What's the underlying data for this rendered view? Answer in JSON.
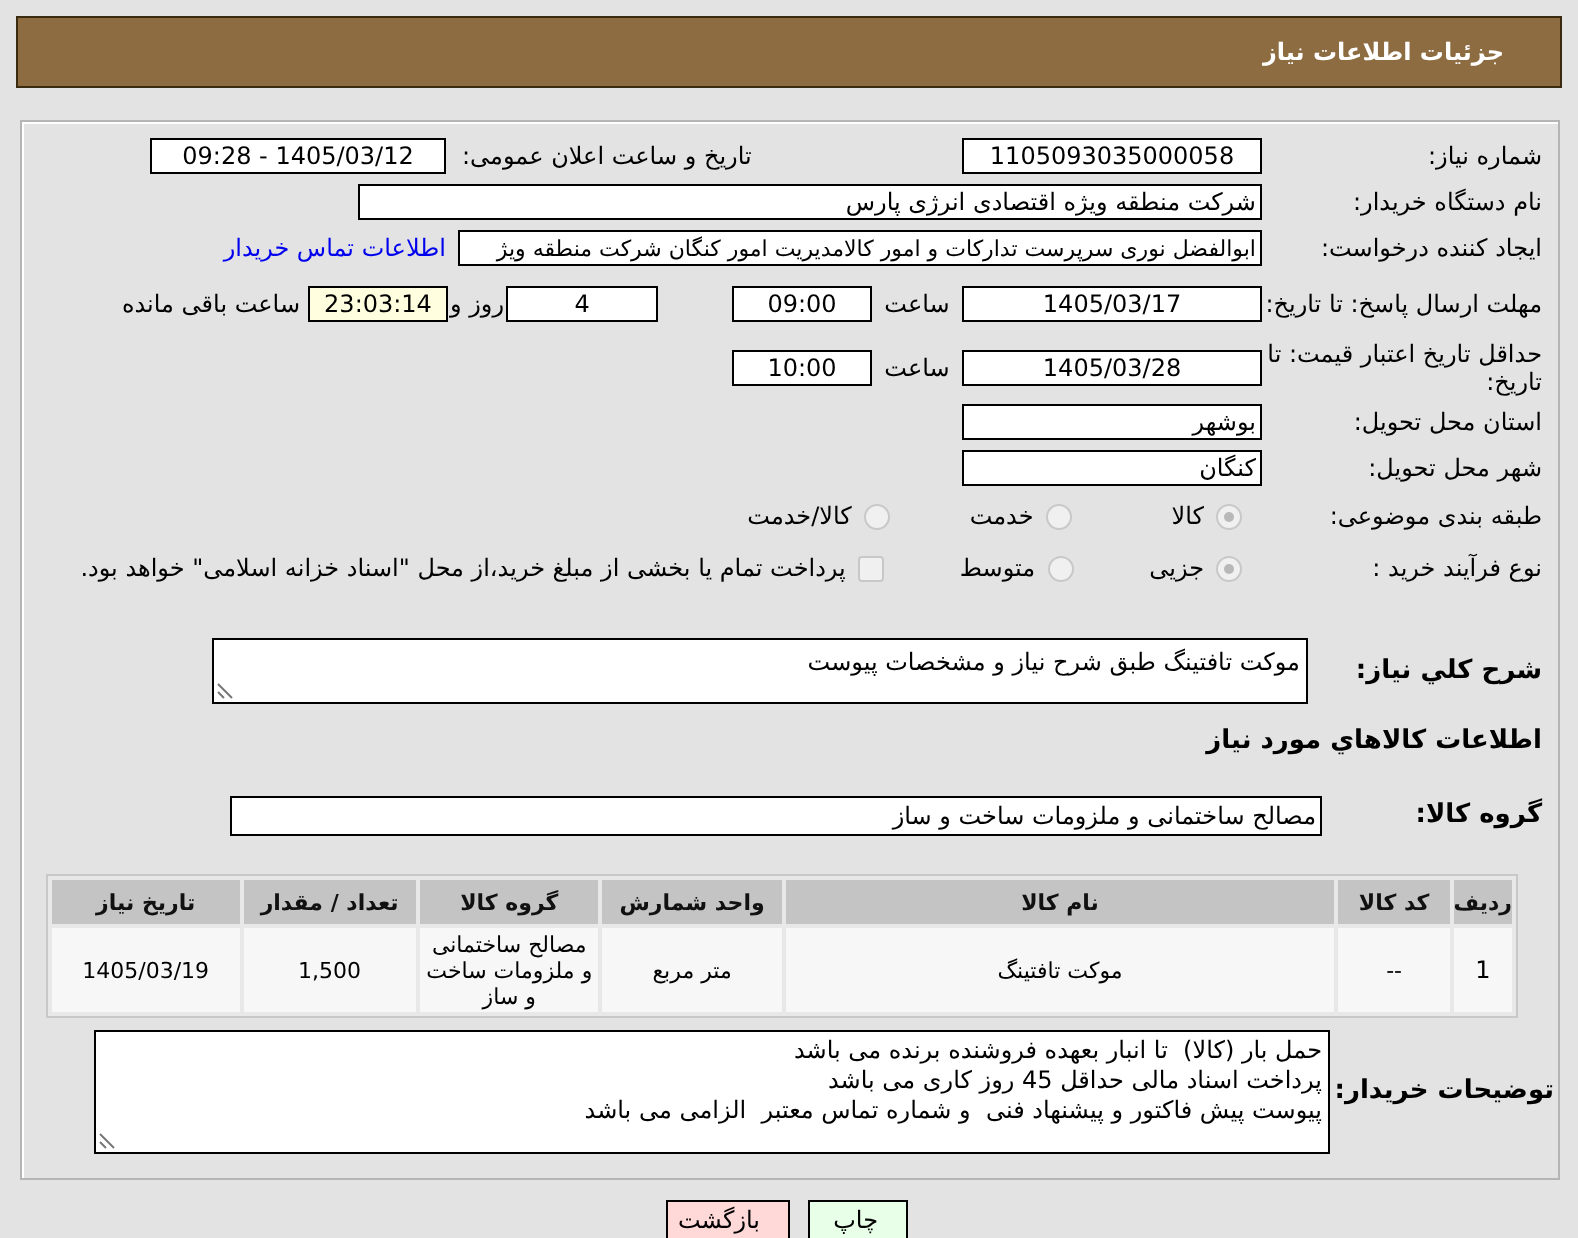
{
  "header": {
    "title": "جزئیات اطلاعات نیاز"
  },
  "need_number": {
    "label": "شماره نیاز:",
    "value": "1105093035000058"
  },
  "announce": {
    "label": "تاریخ و ساعت اعلان عمومی:",
    "value": "1405/03/12 - 09:28"
  },
  "buyer": {
    "label": "نام دستگاه خریدار:",
    "value": "شرکت منطقه ویژه اقتصادی انرژی پارس"
  },
  "requester": {
    "label": "ایجاد کننده درخواست:",
    "value": "ابوالفضل نوری سرپرست تدارکات و امور کالامدیریت امور کنگان شرکت منطقه ویژ",
    "link": "اطلاعات تماس خریدار"
  },
  "deadline": {
    "label": "مهلت ارسال پاسخ: تا تاریخ:",
    "date": "1405/03/17",
    "time_label": "ساعت",
    "time": "09:00",
    "days": "4",
    "days_label": "روز و",
    "remaining": "23:03:14",
    "remaining_label": "ساعت باقی مانده"
  },
  "validity": {
    "label": "حداقل تاریخ اعتبار قیمت: تا تاریخ:",
    "date": "1405/03/28",
    "time_label": "ساعت",
    "time": "10:00"
  },
  "province": {
    "label": "استان محل تحویل:",
    "value": "بوشهر"
  },
  "city": {
    "label": "شهر محل تحویل:",
    "value": "کنگان"
  },
  "category": {
    "label": "طبقه بندی موضوعی:",
    "options": [
      {
        "label": "کالا",
        "selected": true
      },
      {
        "label": "خدمت",
        "selected": false
      },
      {
        "label": "کالا/خدمت",
        "selected": false
      }
    ]
  },
  "process": {
    "label": "نوع فرآیند خرید :",
    "options": [
      {
        "label": "جزیی",
        "selected": true
      },
      {
        "label": "متوسط",
        "selected": false
      }
    ],
    "payment": {
      "label": "پرداخت تمام یا بخشی از مبلغ خرید،از محل \"اسناد خزانه اسلامی\" خواهد بود.",
      "checked": false
    }
  },
  "description": {
    "label": "شرح کلي نیاز:",
    "value": "موکت تافتینگ طبق شرح نیاز و مشخصات پیوست"
  },
  "goods_section": {
    "title": "اطلاعات کالاهاي مورد نياز"
  },
  "goods_group": {
    "label": "گروه کالا:",
    "value": "مصالح ساختمانی و ملزومات ساخت و ساز"
  },
  "table": {
    "columns": [
      "ردیف",
      "کد کالا",
      "نام کالا",
      "واحد شمارش",
      "گروه کالا",
      "تعداد / مقدار",
      "تاریخ نیاز"
    ],
    "rows": [
      [
        "1",
        "--",
        "موکت تافتینگ",
        "متر مربع",
        "مصالح ساختمانی و ملزومات ساخت و ساز",
        "1,500",
        "1405/03/19"
      ]
    ]
  },
  "buyer_notes": {
    "label": "توضیحات خریدار:",
    "lines": [
      "حمل بار (کالا)  تا انبار بعهده فروشنده برنده می باشد",
      "پرداخت اسناد مالی حداقل 45 روز کاری می باشد",
      "پیوست پیش فاکتور و پیشنهاد فنی  و شماره تماس معتبر  الزامی می باشد"
    ]
  },
  "buttons": [
    {
      "label": "چاپ",
      "kind": "print"
    },
    {
      "label": "بازگشت",
      "kind": "back"
    }
  ]
}
